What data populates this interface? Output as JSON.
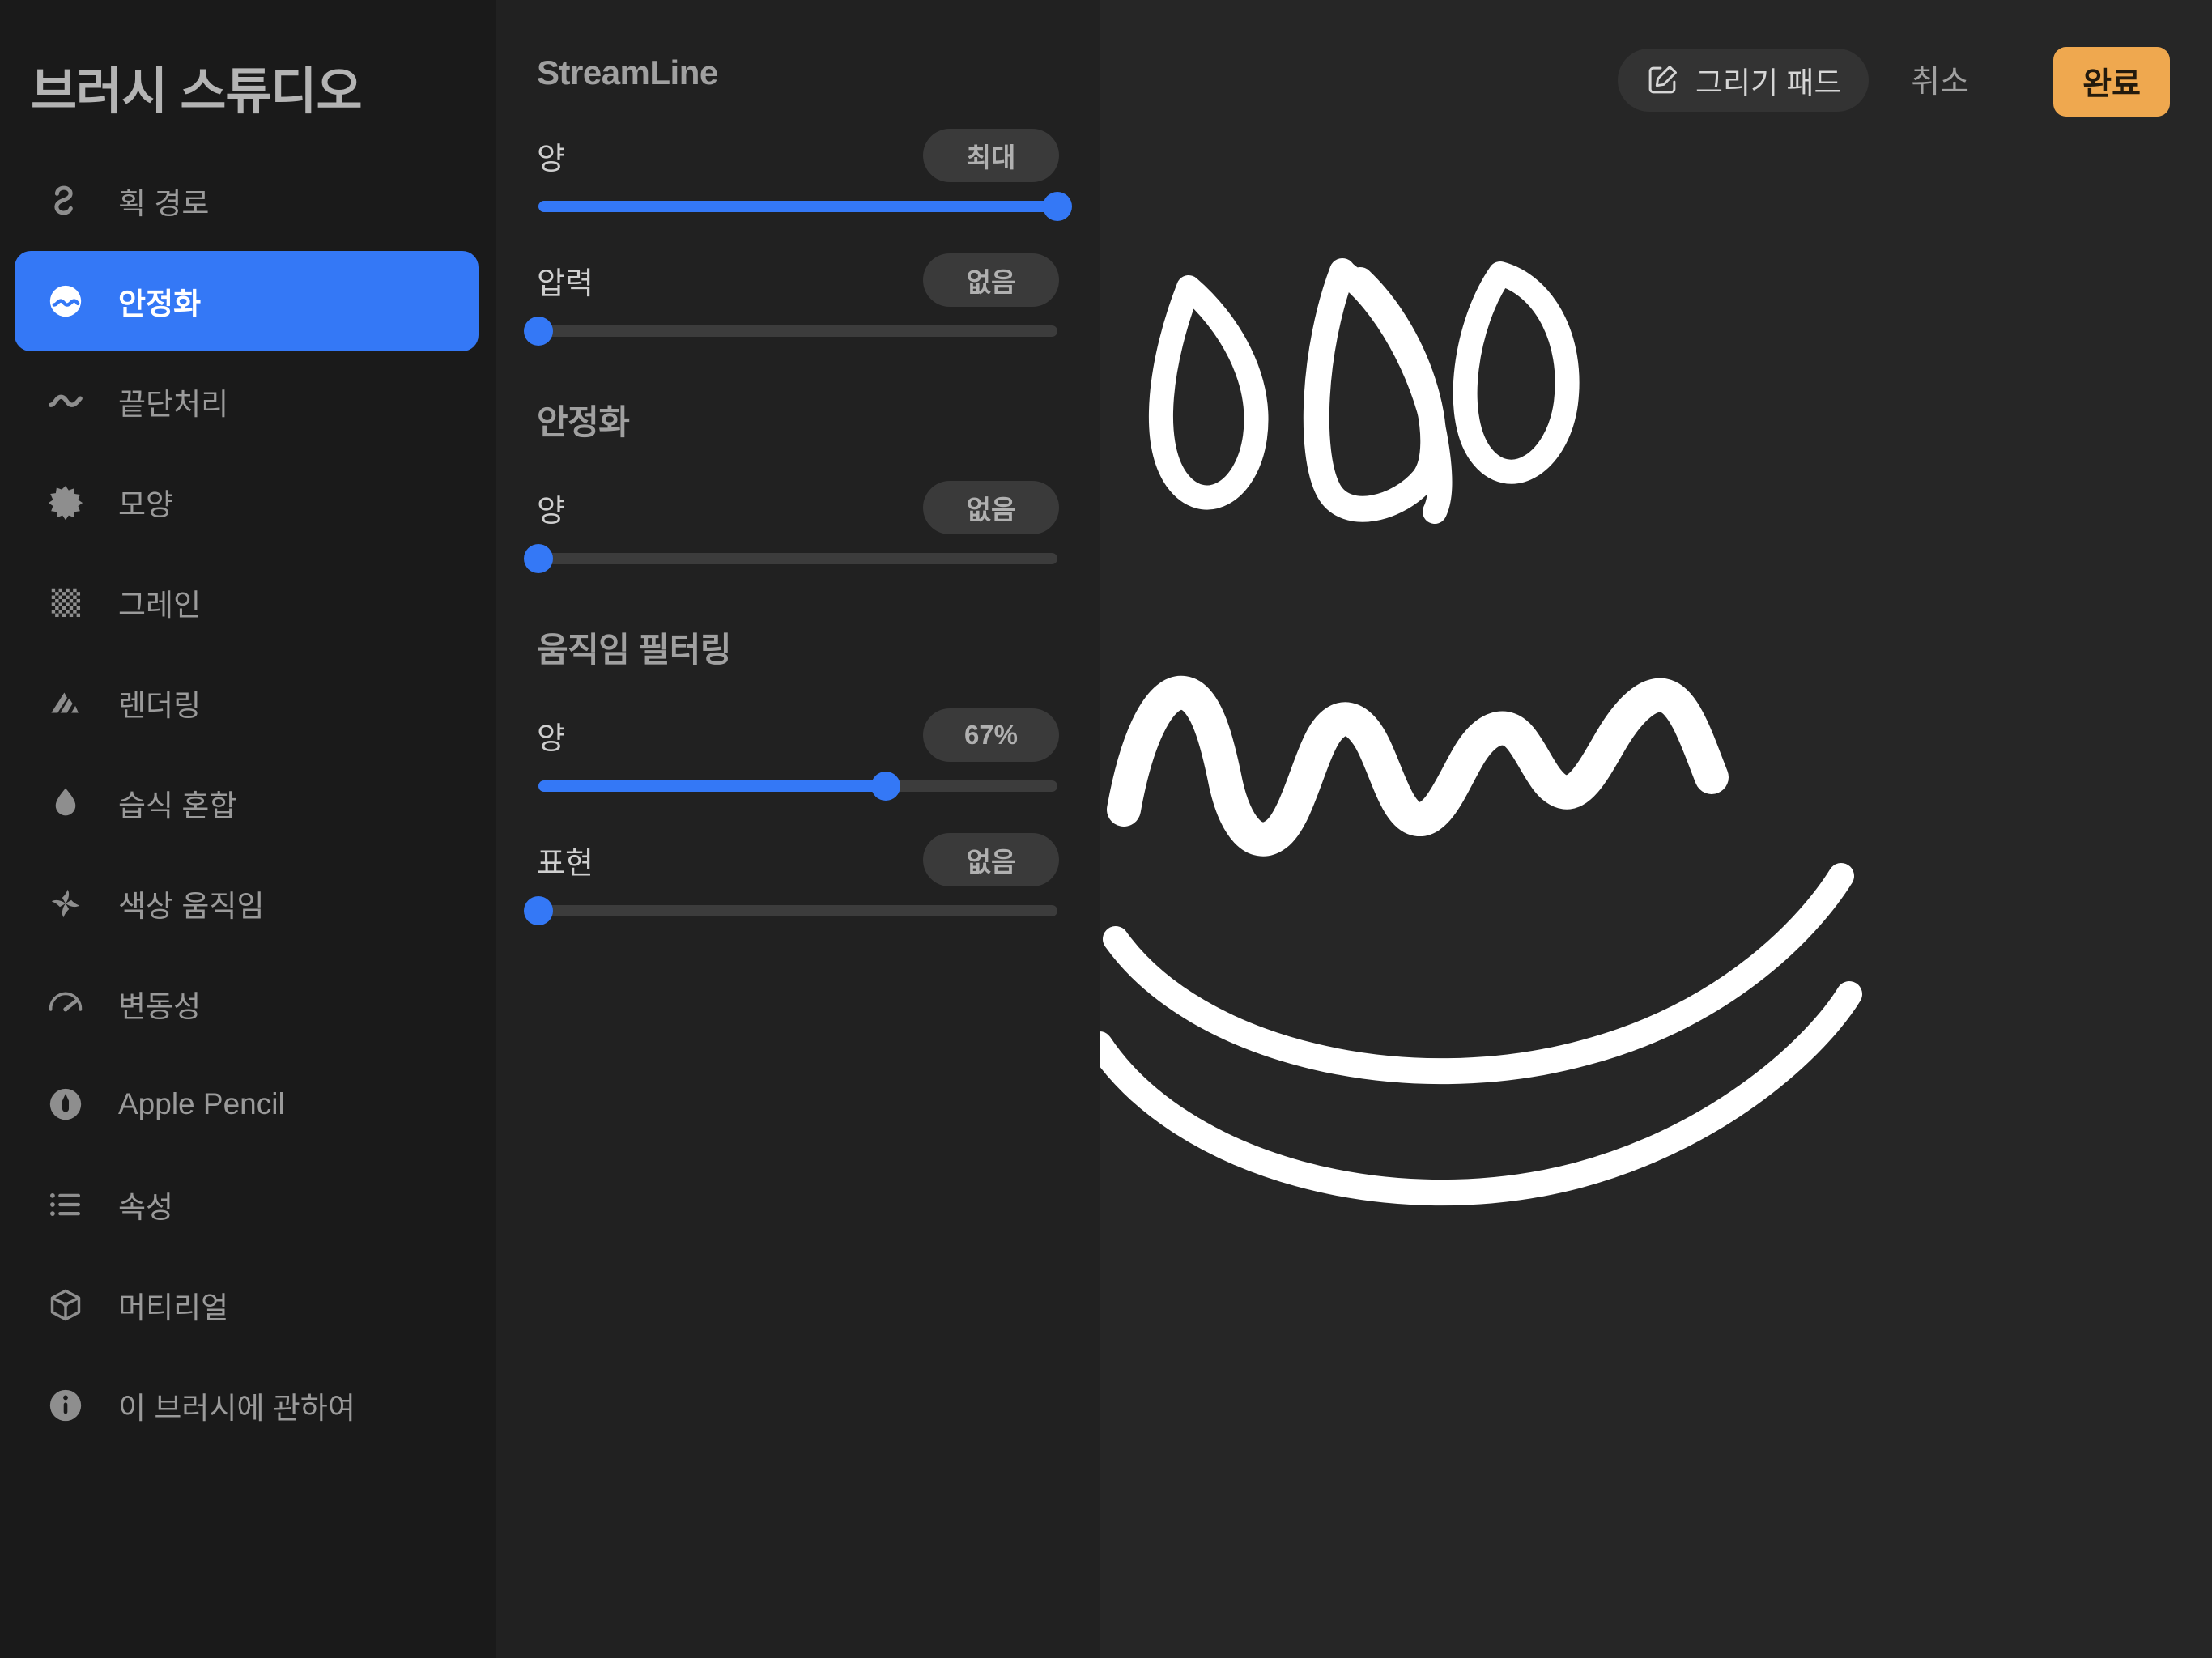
{
  "sidebar": {
    "title": "브러시 스튜디오",
    "items": [
      {
        "label": "획 경로",
        "icon": "stroke-path-icon",
        "selected": false
      },
      {
        "label": "안정화",
        "icon": "stabilization-icon",
        "selected": true
      },
      {
        "label": "끝단처리",
        "icon": "taper-icon",
        "selected": false
      },
      {
        "label": "모양",
        "icon": "shape-icon",
        "selected": false
      },
      {
        "label": "그레인",
        "icon": "grain-icon",
        "selected": false
      },
      {
        "label": "렌더링",
        "icon": "rendering-icon",
        "selected": false
      },
      {
        "label": "습식 혼합",
        "icon": "wet-mix-icon",
        "selected": false
      },
      {
        "label": "색상 움직임",
        "icon": "color-dynamics-icon",
        "selected": false
      },
      {
        "label": "변동성",
        "icon": "dynamics-icon",
        "selected": false
      },
      {
        "label": "Apple Pencil",
        "icon": "apple-pencil-icon",
        "selected": false
      },
      {
        "label": "속성",
        "icon": "properties-icon",
        "selected": false
      },
      {
        "label": "머티리얼",
        "icon": "materials-icon",
        "selected": false
      },
      {
        "label": "이 브러시에 관하여",
        "icon": "info-icon",
        "selected": false
      }
    ]
  },
  "settings": {
    "sections": [
      {
        "title": "StreamLine",
        "controls": [
          {
            "label": "양",
            "value": "최대",
            "fill_pct": 100,
            "knob_pct": 100
          },
          {
            "label": "압력",
            "value": "없음",
            "fill_pct": 0,
            "knob_pct": 0
          }
        ]
      },
      {
        "title": "안정화",
        "controls": [
          {
            "label": "양",
            "value": "없음",
            "fill_pct": 0,
            "knob_pct": 0
          }
        ]
      },
      {
        "title": "움직임 필터링",
        "controls": [
          {
            "label": "양",
            "value": "67%",
            "fill_pct": 67,
            "knob_pct": 67
          },
          {
            "label": "표현",
            "value": "없음",
            "fill_pct": 0,
            "knob_pct": 0
          }
        ]
      }
    ]
  },
  "canvas": {
    "drawing_pad_label": "그리기 패드",
    "drawing_pad_icon": "pencil-square-icon",
    "cancel_label": "취소",
    "done_label": "완료",
    "stroke_color": "#FFFFFF",
    "background_color": "#262626"
  },
  "colors": {
    "accent_blue": "#3478F6",
    "accent_orange": "#EFA84F",
    "sidebar_bg": "#1A1A1A",
    "settings_bg": "#212121",
    "canvas_bg": "#262626",
    "badge_bg": "#3A3A3A",
    "track_bg": "#3C3C3C"
  }
}
